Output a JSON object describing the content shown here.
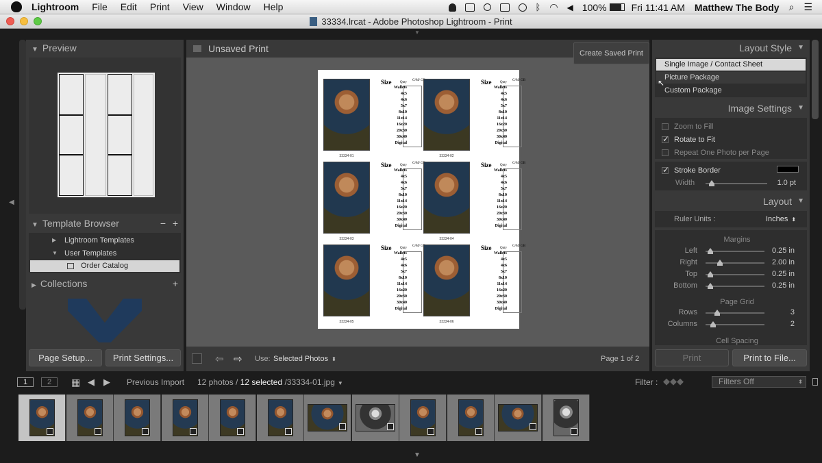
{
  "menubar": {
    "app": "Lightroom",
    "items": [
      "File",
      "Edit",
      "Print",
      "View",
      "Window",
      "Help"
    ],
    "battery": "100%",
    "clock": "Fri 11:41 AM",
    "user": "Matthew The Body"
  },
  "window": {
    "title": "33334.lrcat - Adobe Photoshop Lightroom - Print"
  },
  "left": {
    "preview_header": "Preview",
    "template_browser_header": "Template Browser",
    "template_items": [
      "Lightroom Templates",
      "User Templates",
      "Order Catalog"
    ],
    "collections_header": "Collections",
    "page_setup": "Page Setup...",
    "print_settings": "Print Settings..."
  },
  "center": {
    "title": "Unsaved Print",
    "create_saved": "Create Saved Print",
    "use_label": "Use:",
    "use_value": "Selected Photos",
    "page_of": "Page 1 of 2",
    "chart_title": "Size",
    "chart_qty": "Qnty",
    "chart_gb": "G/M/ GB",
    "sizes": [
      "Wallets",
      "4x5",
      "4x6",
      "5x7",
      "8x10",
      "11x14",
      "16x20",
      "20x30",
      "30x40",
      "Digital"
    ],
    "captions": [
      "33334-01",
      "33334-02",
      "33334-03",
      "33334-04",
      "33334-05",
      "33334-06"
    ]
  },
  "right": {
    "layout_style_header": "Layout Style",
    "layout_styles": [
      "Single Image / Contact Sheet",
      "Picture Package",
      "Custom Package"
    ],
    "image_settings_header": "Image Settings",
    "zoom_to_fill": "Zoom to Fill",
    "rotate_to_fit": "Rotate to Fit",
    "repeat_one": "Repeat One Photo per Page",
    "stroke_border": "Stroke Border",
    "width_label": "Width",
    "width_value": "1.0 pt",
    "width_fraction": 0.05,
    "layout_header": "Layout",
    "ruler_units_label": "Ruler Units :",
    "ruler_units_value": "Inches",
    "margins_label": "Margins",
    "margins": [
      {
        "label": "Left",
        "value": "0.25 in",
        "fraction": 0.03
      },
      {
        "label": "Right",
        "value": "2.00 in",
        "fraction": 0.2
      },
      {
        "label": "Top",
        "value": "0.25 in",
        "fraction": 0.03
      },
      {
        "label": "Bottom",
        "value": "0.25 in",
        "fraction": 0.03
      }
    ],
    "page_grid_label": "Page Grid",
    "grid": [
      {
        "label": "Rows",
        "value": "3",
        "fraction": 0.15
      },
      {
        "label": "Columns",
        "value": "2",
        "fraction": 0.08
      }
    ],
    "cell_spacing_label": "Cell Spacing",
    "print_btn": "Print",
    "print_to_file_btn": "Print to File..."
  },
  "filmbar": {
    "page1": "1",
    "page2": "2",
    "source": "Previous Import",
    "count": "12 photos /",
    "selected": "12 selected",
    "file": "/33334-01.jpg",
    "filter_label": "Filter :",
    "filter_value": "Filters Off"
  }
}
